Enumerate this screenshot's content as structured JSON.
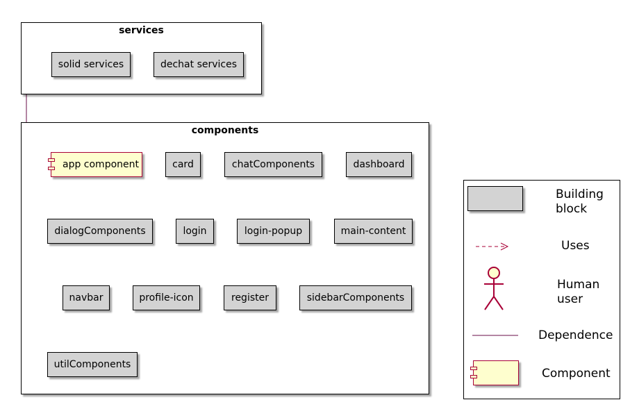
{
  "services": {
    "title": "services",
    "items": [
      "solid services",
      "dechat services"
    ]
  },
  "components": {
    "title": "components",
    "app_component": "app component",
    "items": [
      "card",
      "chatComponents",
      "dashboard",
      "dialogComponents",
      "login",
      "login-popup",
      "main-content",
      "navbar",
      "profile-icon",
      "register",
      "sidebarComponents",
      "utilComponents"
    ]
  },
  "legend": {
    "building_block": "Building block",
    "uses": "Uses",
    "human_user": "Human user",
    "dependence": "Dependence",
    "component": "Component"
  },
  "colors": {
    "block_fill": "#d3d3d3",
    "component_fill": "#fefece",
    "accent": "#a80036",
    "dependence_line": "#6a0e47"
  }
}
